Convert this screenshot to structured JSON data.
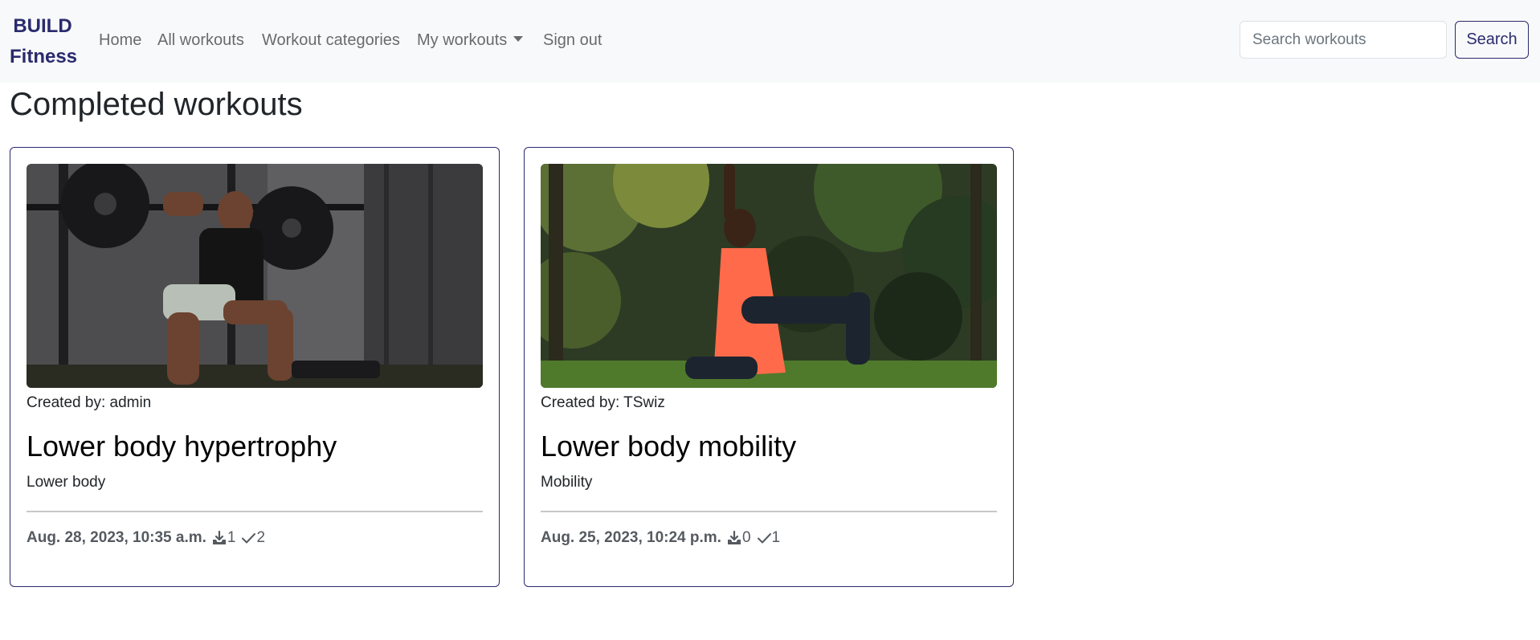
{
  "navbar": {
    "brand_line1": "BUILD",
    "brand_line2": "Fitness",
    "links": {
      "home": "Home",
      "all_workouts": "All workouts",
      "workout_categories": "Workout categories",
      "my_workouts": "My workouts",
      "sign_out": "Sign out"
    },
    "search": {
      "placeholder": "Search workouts",
      "value": "",
      "button_label": "Search"
    }
  },
  "page": {
    "title": "Completed workouts"
  },
  "colors": {
    "brand": "#2a2a6e",
    "navbar_bg": "#f8f9fa",
    "text": "#212529",
    "muted": "#555a60"
  },
  "cards": [
    {
      "image_icon": "squat-photo",
      "creator": "Created by: admin",
      "title": "Lower body hypertrophy",
      "category": "Lower body",
      "date": "Aug. 28, 2023, 10:35 a.m.",
      "saves_icon": "download-tray-icon",
      "saves_count": "1",
      "completions_icon": "check-icon",
      "completions_count": "2"
    },
    {
      "image_icon": "lunge-stretch-photo",
      "creator": "Created by: TSwiz",
      "title": "Lower body mobility",
      "category": "Mobility",
      "date": "Aug. 25, 2023, 10:24 p.m.",
      "saves_icon": "download-tray-icon",
      "saves_count": "0",
      "completions_icon": "check-icon",
      "completions_count": "1"
    }
  ]
}
